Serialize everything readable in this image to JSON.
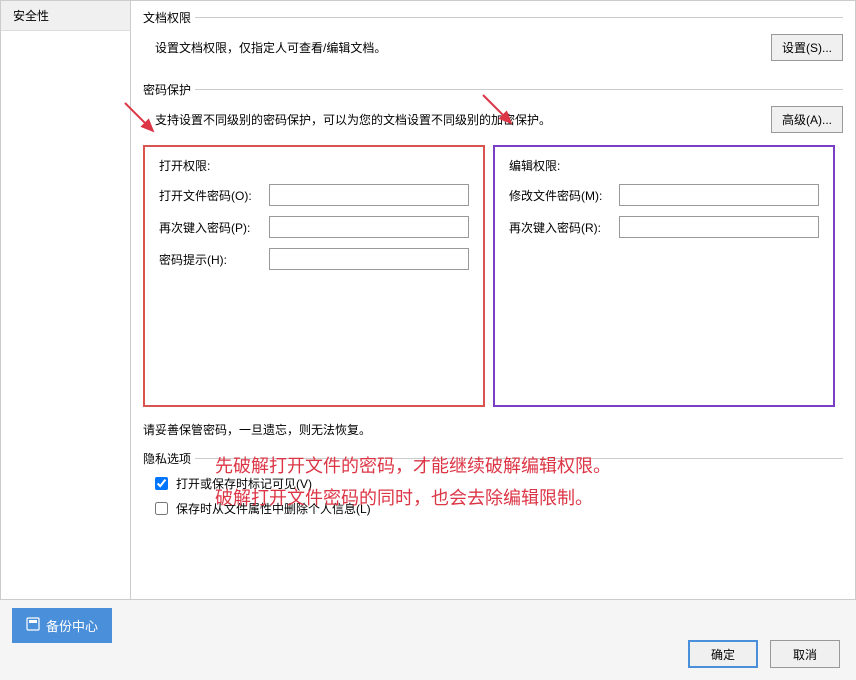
{
  "sidebar": {
    "security": "安全性"
  },
  "doc_perm": {
    "legend": "文档权限",
    "desc": "设置文档权限，仅指定人可查看/编辑文档。",
    "btn": "设置(S)..."
  },
  "pwd_protect": {
    "legend": "密码保护",
    "desc": "支持设置不同级别的密码保护，可以为您的文档设置不同级别的加密保护。",
    "btn": "高级(A)..."
  },
  "open_perm": {
    "title": "打开权限:",
    "pwd_label": "打开文件密码(O):",
    "pwd_value": "",
    "repwd_label": "再次键入密码(P):",
    "repwd_value": "",
    "hint_label": "密码提示(H):",
    "hint_value": ""
  },
  "edit_perm": {
    "title": "编辑权限:",
    "pwd_label": "修改文件密码(M):",
    "pwd_value": "",
    "repwd_label": "再次键入密码(R):",
    "repwd_value": ""
  },
  "note": "请妥善保管密码，一旦遗忘，则无法恢复。",
  "privacy": {
    "legend": "隐私选项",
    "opt1": "打开或保存时标记可见(V)",
    "opt2": "保存时从文件属性中删除个人信息(L)"
  },
  "annotation": {
    "line1": "先破解打开文件的密码，才能继续破解编辑权限。",
    "line2": "破解打开文件密码的同时，也会去除编辑限制。"
  },
  "backup_btn": "备份中心",
  "buttons": {
    "ok": "确定",
    "cancel": "取消"
  }
}
